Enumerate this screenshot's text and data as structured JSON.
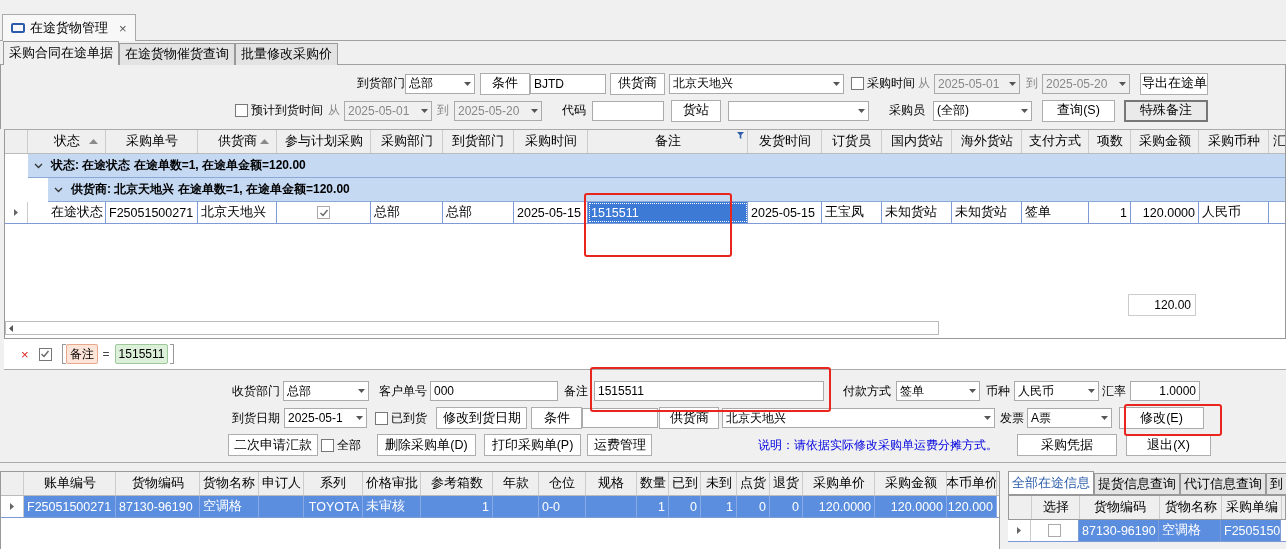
{
  "document_tab": {
    "title": "在途货物管理",
    "close": "×"
  },
  "tabs": [
    {
      "label": "采购合同在途单据",
      "selected": true
    },
    {
      "label": "在途货物催货查询",
      "selected": false
    },
    {
      "label": "批量修改采购价",
      "selected": false
    }
  ],
  "filters": {
    "dept": {
      "label": "到货部门",
      "value": "总部"
    },
    "condition_button": "条件",
    "condition_value": "BJTD",
    "supplier_button": "供货商",
    "supplier": "北京天地兴",
    "purchase_time": {
      "label": "采购时间",
      "checked": false,
      "from": "从",
      "start": "2025-05-01",
      "to": "到",
      "end": "2025-05-20"
    },
    "export_button": "导出在途单",
    "expected_time": {
      "label": "预计到货时间",
      "checked": false,
      "from": "从",
      "start": "2025-05-01",
      "to": "到",
      "end": "2025-05-20"
    },
    "code_label": "代码",
    "station_button": "货站",
    "buyer": {
      "label": "采购员",
      "value": "(全部)"
    },
    "query_button": "查询(S)",
    "remark_button": "特殊备注"
  },
  "grid": {
    "columns": [
      {
        "label": "状态",
        "sorted": true,
        "filtered": false
      },
      {
        "label": "采购单号",
        "sorted": false,
        "filtered": false
      },
      {
        "label": "供货商",
        "sorted": true,
        "filtered": false
      },
      {
        "label": "参与计划采购",
        "sorted": false,
        "filtered": false
      },
      {
        "label": "采购部门",
        "sorted": false,
        "filtered": false
      },
      {
        "label": "到货部门",
        "sorted": false,
        "filtered": false
      },
      {
        "label": "采购时间",
        "sorted": false,
        "filtered": false
      },
      {
        "label": "备注",
        "sorted": false,
        "filtered": true
      },
      {
        "label": "发货时间",
        "sorted": false,
        "filtered": false
      },
      {
        "label": "订货员",
        "sorted": false,
        "filtered": false
      },
      {
        "label": "国内货站",
        "sorted": false,
        "filtered": false
      },
      {
        "label": "海外货站",
        "sorted": false,
        "filtered": false
      },
      {
        "label": "支付方式",
        "sorted": false,
        "filtered": false
      },
      {
        "label": "项数",
        "sorted": false,
        "filtered": false
      },
      {
        "label": "采购金额",
        "sorted": false,
        "filtered": false
      },
      {
        "label": "采购币种",
        "sorted": false,
        "filtered": false
      },
      {
        "label": "汇"
      }
    ],
    "groups": [
      {
        "text": "状态: 在途状态 在途单数=1, 在途单金额=120.00",
        "expanded": true,
        "children": [
          {
            "text": "供货商: 北京天地兴 在途单数=1, 在途单金额=120.00",
            "expanded": true,
            "rows": [
              {
                "current": true,
                "cells": [
                  {
                    "kind": "text",
                    "text": "在途状态",
                    "selected": false
                  },
                  {
                    "kind": "text",
                    "text": "F25051500271",
                    "selected": false
                  },
                  {
                    "kind": "text",
                    "text": "北京天地兴",
                    "selected": false
                  },
                  {
                    "kind": "check",
                    "checked": true,
                    "selected": false
                  },
                  {
                    "kind": "text",
                    "text": "总部",
                    "selected": false
                  },
                  {
                    "kind": "text",
                    "text": "总部",
                    "selected": false
                  },
                  {
                    "kind": "text",
                    "text": "2025-05-15",
                    "selected": false
                  },
                  {
                    "kind": "text",
                    "text": "1515511",
                    "selected": true
                  },
                  {
                    "kind": "text",
                    "text": "2025-05-15",
                    "selected": false
                  },
                  {
                    "kind": "text",
                    "text": "王宝凤",
                    "selected": false
                  },
                  {
                    "kind": "text",
                    "text": "未知货站",
                    "selected": false
                  },
                  {
                    "kind": "text",
                    "text": "未知货站",
                    "selected": false
                  },
                  {
                    "kind": "text",
                    "text": "签单",
                    "selected": false
                  },
                  {
                    "kind": "text",
                    "text": "1",
                    "selected": false
                  },
                  {
                    "kind": "text",
                    "text": "120.0000",
                    "selected": false
                  },
                  {
                    "kind": "text",
                    "text": "人民币",
                    "selected": false
                  }
                ]
              }
            ]
          }
        ]
      }
    ],
    "total": "120.00"
  },
  "filter_bar": {
    "remove": "×",
    "enabled": true,
    "field": "备注",
    "operator": "=",
    "value": "1515511"
  },
  "edit_form": {
    "receiving_dept": {
      "label": "收货部门",
      "value": "总部"
    },
    "customer_no": {
      "label": "客户单号",
      "value": "000"
    },
    "remark": {
      "label": "备注",
      "value": "1515511"
    },
    "payment": {
      "label": "付款方式",
      "value": "签单"
    },
    "currency": {
      "label": "币种",
      "value": "人民币"
    },
    "rate": {
      "label": "汇率",
      "value": "1.0000"
    },
    "arrival_date": {
      "label": "到货日期",
      "value": "2025-05-1"
    },
    "arrived": {
      "label": "已到货",
      "checked": false
    },
    "change_date_button": "修改到货日期",
    "condition_button": "条件",
    "supplier_button": "供货商",
    "supplier": "北京天地兴",
    "invoice": {
      "label": "发票",
      "value": "A票"
    },
    "modify_button": "修改(E)",
    "remit_button": "二次申请汇款",
    "all": {
      "label": "全部",
      "checked": false
    },
    "delete_button": "删除采购单(D)",
    "print_button": "打印采购单(P)",
    "freight_button": "运费管理",
    "note": "说明：请依据实际修改采购单运费分摊方式。",
    "voucher_button": "采购凭据",
    "exit_button": "退出(X)"
  },
  "detail_grid": {
    "columns": [
      "账单编号",
      "货物编码",
      "货物名称",
      "申订人",
      "系列",
      "价格审批",
      "参考箱数",
      "年款",
      "仓位",
      "规格",
      "数量",
      "已到",
      "未到",
      "点货",
      "退货",
      "采购单价",
      "采购金额",
      "本币单价"
    ],
    "rows": [
      {
        "selected": true,
        "current": true,
        "cells": [
          "F25051500271",
          "87130-96190",
          "空调格",
          "",
          "TOYOTA",
          "未审核",
          "1",
          "",
          "0-0",
          "",
          "1",
          "0",
          "1",
          "0",
          "0",
          "120.0000",
          "120.0000",
          "120.000"
        ]
      }
    ]
  },
  "side_panel": {
    "tabs": [
      {
        "label": "全部在途信息",
        "selected": true
      },
      {
        "label": "提货信息查询",
        "selected": false
      },
      {
        "label": "代订信息查询",
        "selected": false
      },
      {
        "label": "到",
        "selected": false
      }
    ],
    "columns": [
      "选择",
      "货物编码",
      "货物名称",
      "采购单编"
    ],
    "rows": [
      {
        "current": true,
        "cells": [
          {
            "kind": "check",
            "checked": false
          },
          {
            "kind": "text",
            "text": "87130-96190"
          },
          {
            "kind": "text",
            "text": "空调格"
          },
          {
            "kind": "text",
            "text": "F2505150"
          }
        ]
      }
    ]
  }
}
